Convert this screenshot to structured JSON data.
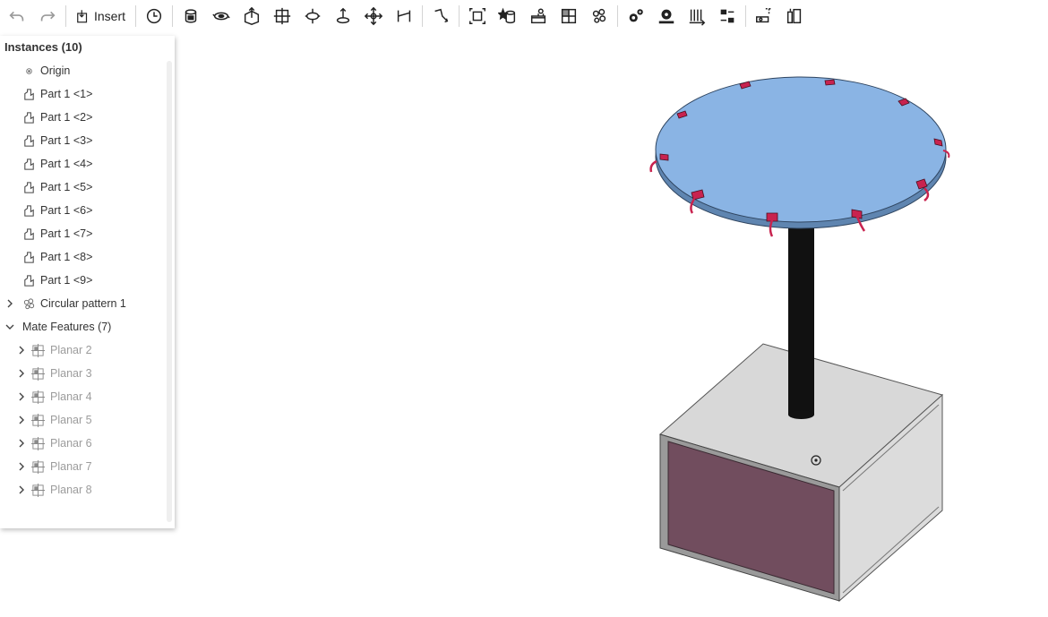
{
  "toolbar": {
    "insert_label": "Insert"
  },
  "panel": {
    "title": "Instances (10)",
    "items": [
      {
        "label": "Origin",
        "icon": "origin-icon"
      },
      {
        "label": "Part 1 <1>",
        "icon": "part-icon"
      },
      {
        "label": "Part 1 <2>",
        "icon": "part-icon"
      },
      {
        "label": "Part 1 <3>",
        "icon": "part-icon"
      },
      {
        "label": "Part 1 <4>",
        "icon": "part-icon"
      },
      {
        "label": "Part 1 <5>",
        "icon": "part-icon"
      },
      {
        "label": "Part 1 <6>",
        "icon": "part-icon"
      },
      {
        "label": "Part 1 <7>",
        "icon": "part-icon"
      },
      {
        "label": "Part 1 <8>",
        "icon": "part-icon"
      },
      {
        "label": "Part 1 <9>",
        "icon": "part-icon"
      },
      {
        "label": "Circular pattern 1",
        "icon": "pattern-icon"
      }
    ],
    "mate_group": {
      "label": "Mate Features (7)"
    },
    "mates": [
      {
        "label": "Planar 2"
      },
      {
        "label": "Planar 3"
      },
      {
        "label": "Planar 4"
      },
      {
        "label": "Planar 5"
      },
      {
        "label": "Planar 6"
      },
      {
        "label": "Planar 7"
      },
      {
        "label": "Planar 8"
      }
    ]
  },
  "colors": {
    "tabletop": "#8ab4e4",
    "tabletop_edge": "#5f85b0",
    "post": "#111111",
    "box_top": "#d8d8d8",
    "box_side": "#dcdcdc",
    "box_front": "#714d5e",
    "clip": "#c8234f"
  }
}
